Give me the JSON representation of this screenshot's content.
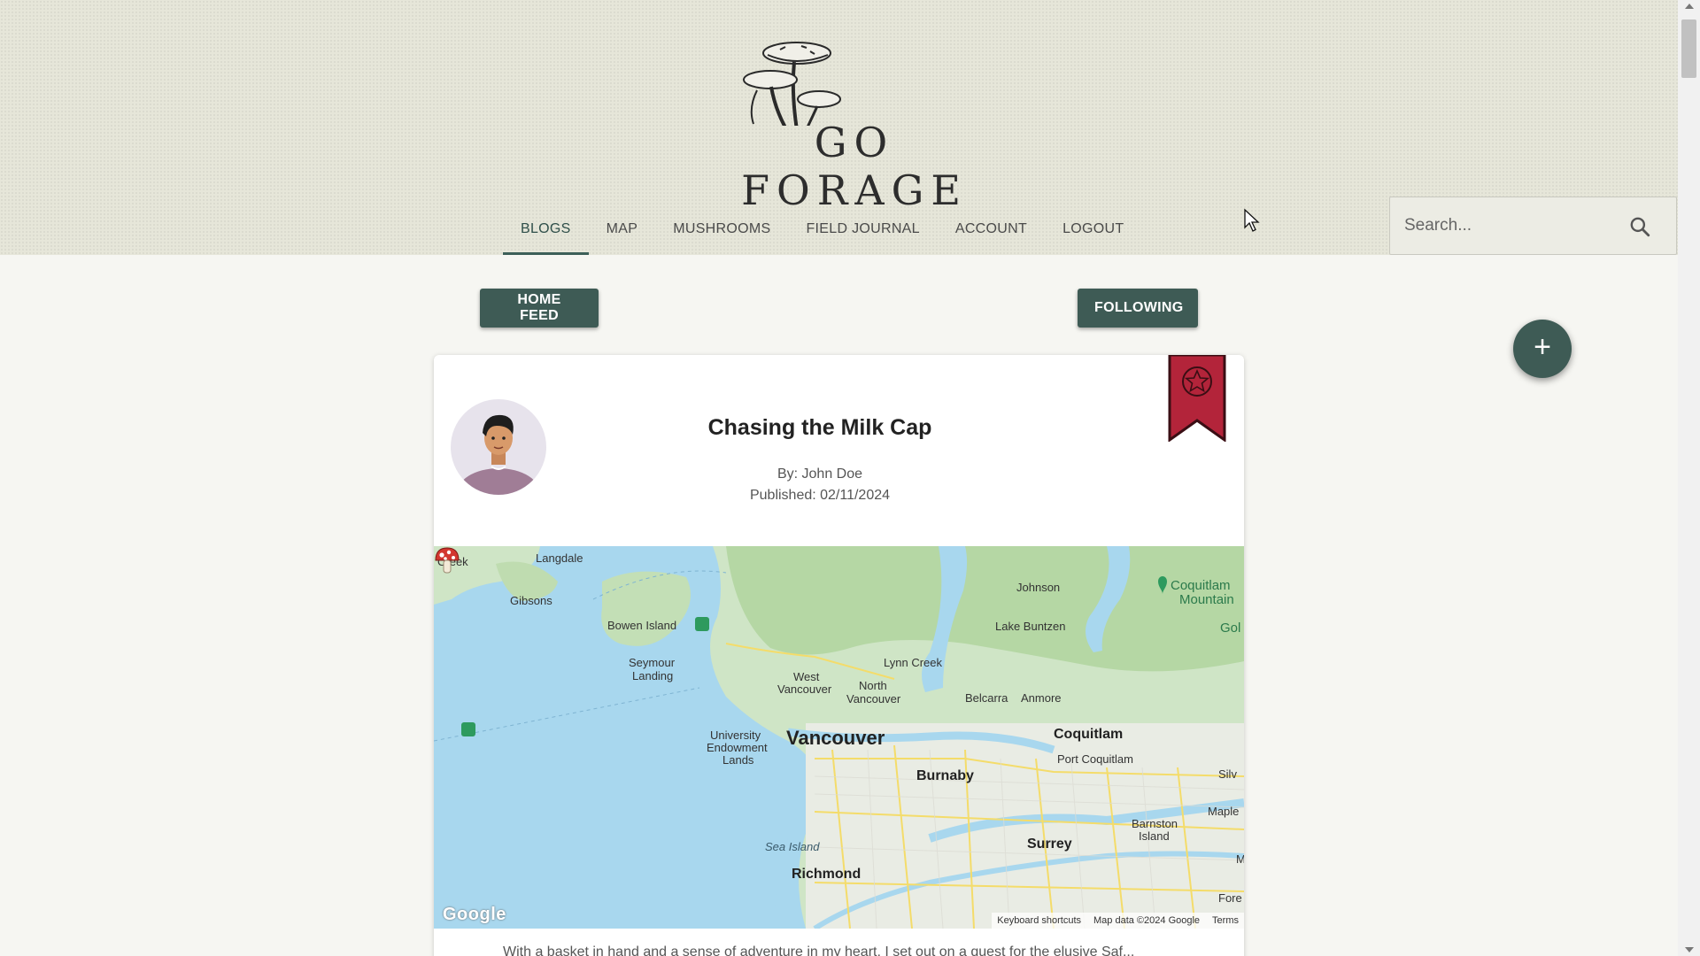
{
  "logo": {
    "wordmark": "GO FORAGE"
  },
  "nav": {
    "items": [
      "BLOGS",
      "MAP",
      "MUSHROOMS",
      "FIELD JOURNAL",
      "ACCOUNT",
      "LOGOUT"
    ],
    "active": "BLOGS"
  },
  "search": {
    "placeholder": "Search..."
  },
  "feed": {
    "home_label": "HOME FEED",
    "following_label": "FOLLOWING",
    "add_label": "+"
  },
  "post": {
    "title": "Chasing the Milk Cap",
    "author": "By: John Doe",
    "published": "Published: 02/11/2024",
    "excerpt": "With a basket in hand and a sense of adventure in my heart, I set out on a quest for the elusive Saf..."
  },
  "map": {
    "labels": {
      "creek": "Creek",
      "langdale": "Langdale",
      "gibsons": "Gibsons",
      "bowen": "Bowen Island",
      "seymour1": "Seymour",
      "seymour2": "Landing",
      "johnson": "Johnson",
      "coquitlam_mtn1": "Coquitlam",
      "coquitlam_mtn2": "Mountain",
      "gol": "Gol",
      "lake_buntzen": "Lake Buntzen",
      "lynn_creek": "Lynn Creek",
      "west_van1": "West",
      "west_van2": "Vancouver",
      "north_van1": "North",
      "north_van2": "Vancouver",
      "belcarra": "Belcarra",
      "anmore": "Anmore",
      "ube1": "University",
      "ube2": "Endowment",
      "ube3": "Lands",
      "vancouver": "Vancouver",
      "coquitlam": "Coquitlam",
      "port_coquitlam": "Port Coquitlam",
      "burnaby": "Burnaby",
      "silv": "Silv",
      "maple": "Maple",
      "barnston1": "Barnston",
      "barnston2": "Island",
      "sea_island": "Sea Island",
      "surrey": "Surrey",
      "richmond": "Richmond",
      "m": "M",
      "fore": "Fore"
    },
    "google": "Google",
    "footer": {
      "shortcuts": "Keyboard shortcuts",
      "data": "Map data ©2024 Google",
      "terms": "Terms"
    }
  },
  "colors": {
    "accent": "#3e5b55",
    "bookmark": "#b3243a",
    "header_bg": "#e6e6d9"
  }
}
